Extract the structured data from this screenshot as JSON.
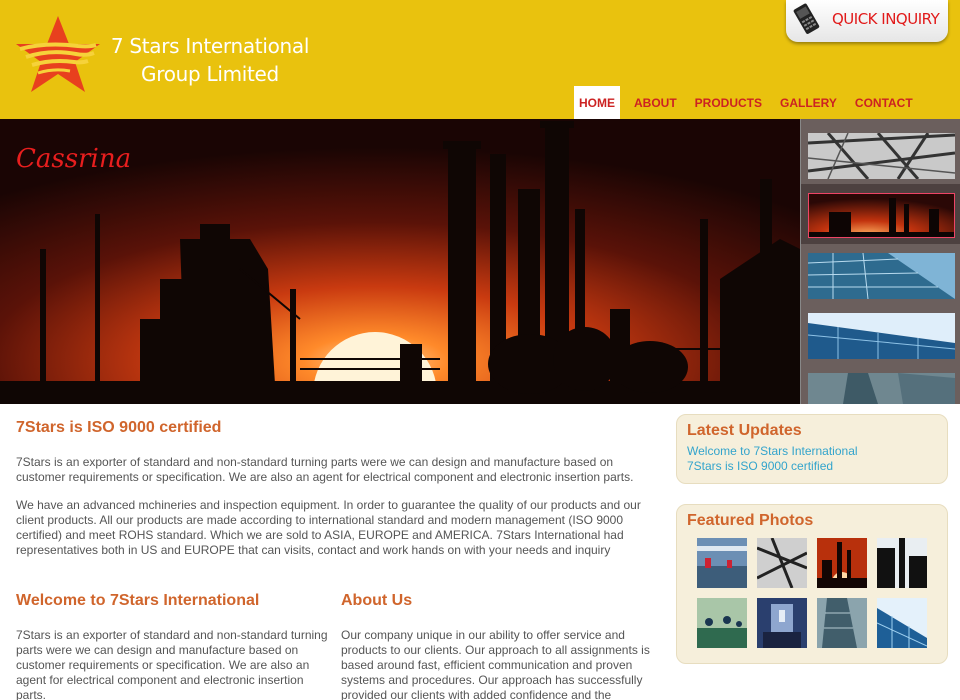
{
  "brand": {
    "line1": "7 Stars International",
    "line2": "Group Limited"
  },
  "quick_inquiry": {
    "label": "QUICK INQUIRY"
  },
  "nav": {
    "items": [
      {
        "label": "HOME",
        "active": true
      },
      {
        "label": "ABOUT",
        "active": false
      },
      {
        "label": "PRODUCTS",
        "active": false
      },
      {
        "label": "GALLERY",
        "active": false
      },
      {
        "label": "CONTACT",
        "active": false
      }
    ]
  },
  "banner": {
    "signature": "Cassrina",
    "thumbnails": [
      "steel-structure",
      "refinery-sunset",
      "glass-building",
      "skyscraper-blue",
      "tower-sky"
    ]
  },
  "main": {
    "title": "7Stars is ISO 9000 certified",
    "para1": "7Stars is an exporter of standard and non-standard turning parts were we can design and manufacture based on customer requirements or specification. We are also an agent for electrical component and electronic insertion parts.",
    "para2": "We have an advanced mchineries and inspection equipment. In order to guarantee the quality of our products and our client products. All our products are made according to international standard and modern management (ISO 9000 certified) and meet ROHS standard. Which we are sold to ASIA, EUROPE and AMERICA. 7Stars International had representatives both in US and EUROPE that can visits, contact and work hands on with your needs and inquiry",
    "welcome_title": "Welcome to 7Stars International",
    "welcome_text": "7Stars is an exporter of standard and non-standard turning parts were we can design and manufacture based on customer requirements or specification. We are also an agent for electrical component and electronic insertion parts.",
    "about_title": "About Us",
    "about_text": "Our company unique in our ability to offer service and products to our clients. Our approach to all assignments is based around fast, efficient communication and proven systems and procedures. Our approach has successfully provided our clients with added confidence and the"
  },
  "sidebar": {
    "updates_title": "Latest Updates",
    "updates": [
      "Welcome to 7Stars International",
      "7Stars is ISO 9000 certified"
    ],
    "photos_title": "Featured Photos",
    "photos": [
      "factory-floor",
      "steel-structure",
      "refinery-sunset",
      "industrial-silhouette",
      "assembly-line",
      "machine-room",
      "glass-building",
      "skyscraper-blue"
    ]
  },
  "colors": {
    "header_bg": "#e9c20e",
    "nav_text": "#cc2222",
    "heading": "#d0652c",
    "link": "#33a4cc",
    "sidebar_bg": "#f6efdb"
  }
}
